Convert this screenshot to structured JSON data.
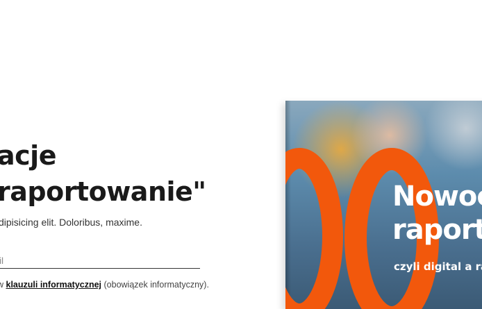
{
  "hero": {
    "headline_line1": "acje",
    "headline_line2": "raportowanie\"",
    "lead": "dipisicing elit. Doloribus, maxime."
  },
  "form": {
    "email_placeholder": "ail"
  },
  "consent": {
    "prefix": "w ",
    "link_label": "klauzuli informatycznej",
    "suffix": " (obowiązek informatyczny)."
  },
  "cover": {
    "title_line1": "Nowoc",
    "title_line2": "raport",
    "subtitle": "czyli digital a ra",
    "accent_color": "#f2580c"
  }
}
